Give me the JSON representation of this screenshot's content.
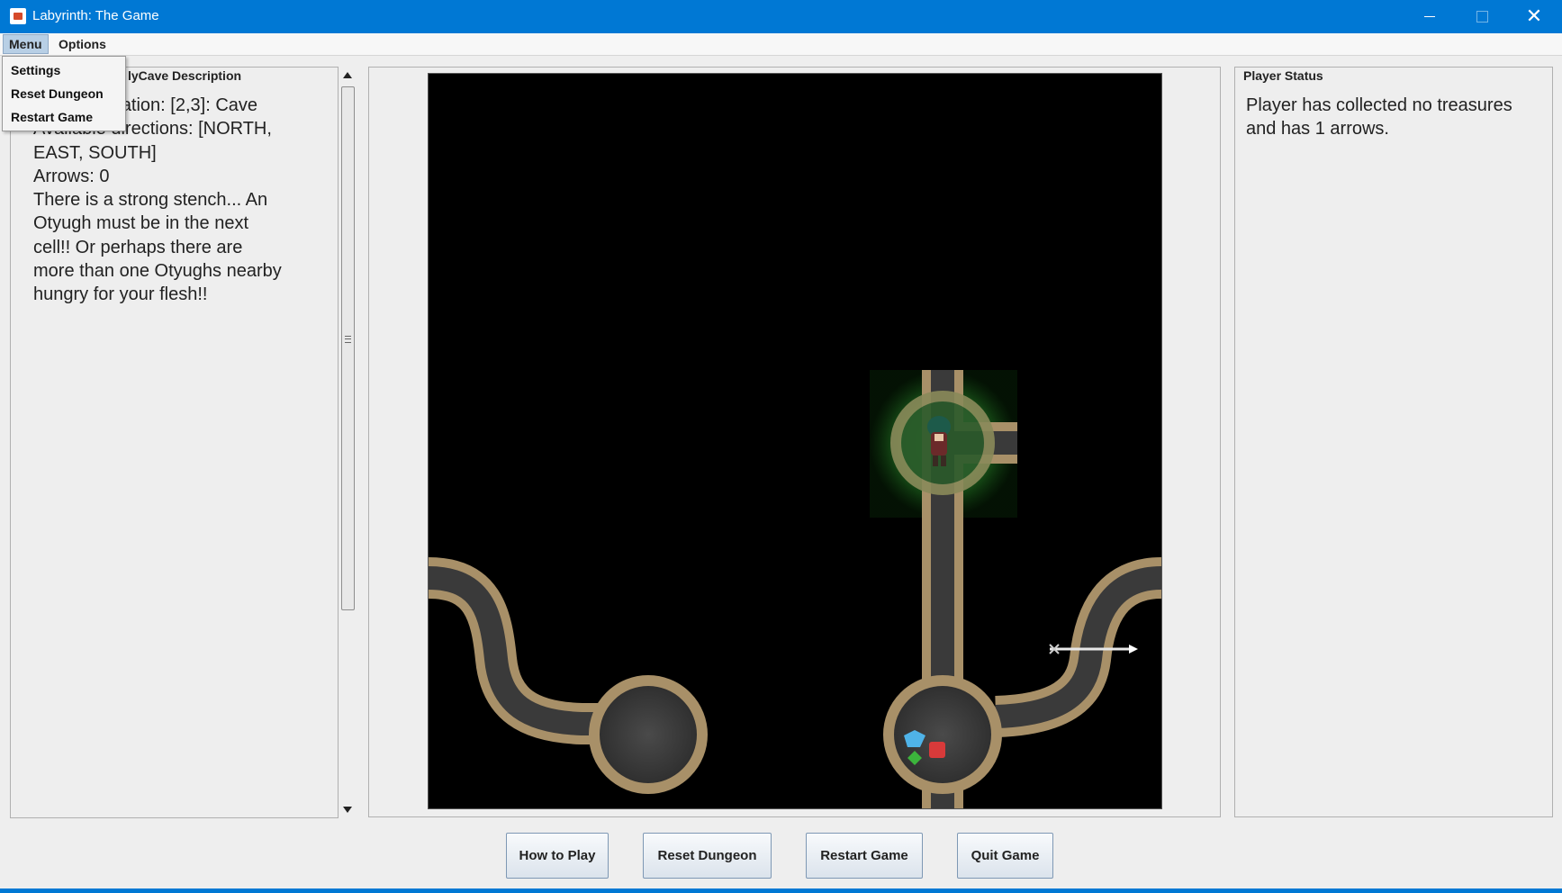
{
  "window": {
    "title": "Labyrinth: The Game",
    "accent_color": "#0078d4"
  },
  "menubar": {
    "items": [
      "Menu",
      "Options"
    ],
    "open_menu": {
      "items": [
        "Settings",
        "Reset Dungeon",
        "Restart Game"
      ]
    }
  },
  "left_panel": {
    "title": "lyCave Description",
    "lines": [
      "Current location: [2,3]: Cave",
      "Available directions: [NORTH,",
      "EAST, SOUTH]",
      "Arrows: 0",
      "There is a strong stench... An",
      "Otyugh must be in the next",
      "cell!! Or perhaps there are",
      "more than one Otyughs nearby",
      "hungry for your flesh!!"
    ]
  },
  "right_panel": {
    "title": "Player Status",
    "text": "Player has collected no treasures and has 1 arrows."
  },
  "buttons": {
    "how_to_play": "How to Play",
    "reset_dungeon": "Reset Dungeon",
    "restart_game": "Restart Game",
    "quit_game": "Quit Game"
  },
  "icons": {
    "app": "java-cup-icon",
    "minimize": "minimize-icon",
    "maximize": "maximize-icon",
    "close": "close-icon",
    "scroll_up": "arrow-up-icon",
    "scroll_down": "arrow-down-icon",
    "player": "player-sprite-icon",
    "arrow": "arrow-item-icon",
    "treasure": "treasure-gems-icon"
  },
  "colors": {
    "player_glow": "#3cb43c",
    "tunnel_border": "#a89068",
    "tunnel_floor": "#3a3a3a"
  }
}
